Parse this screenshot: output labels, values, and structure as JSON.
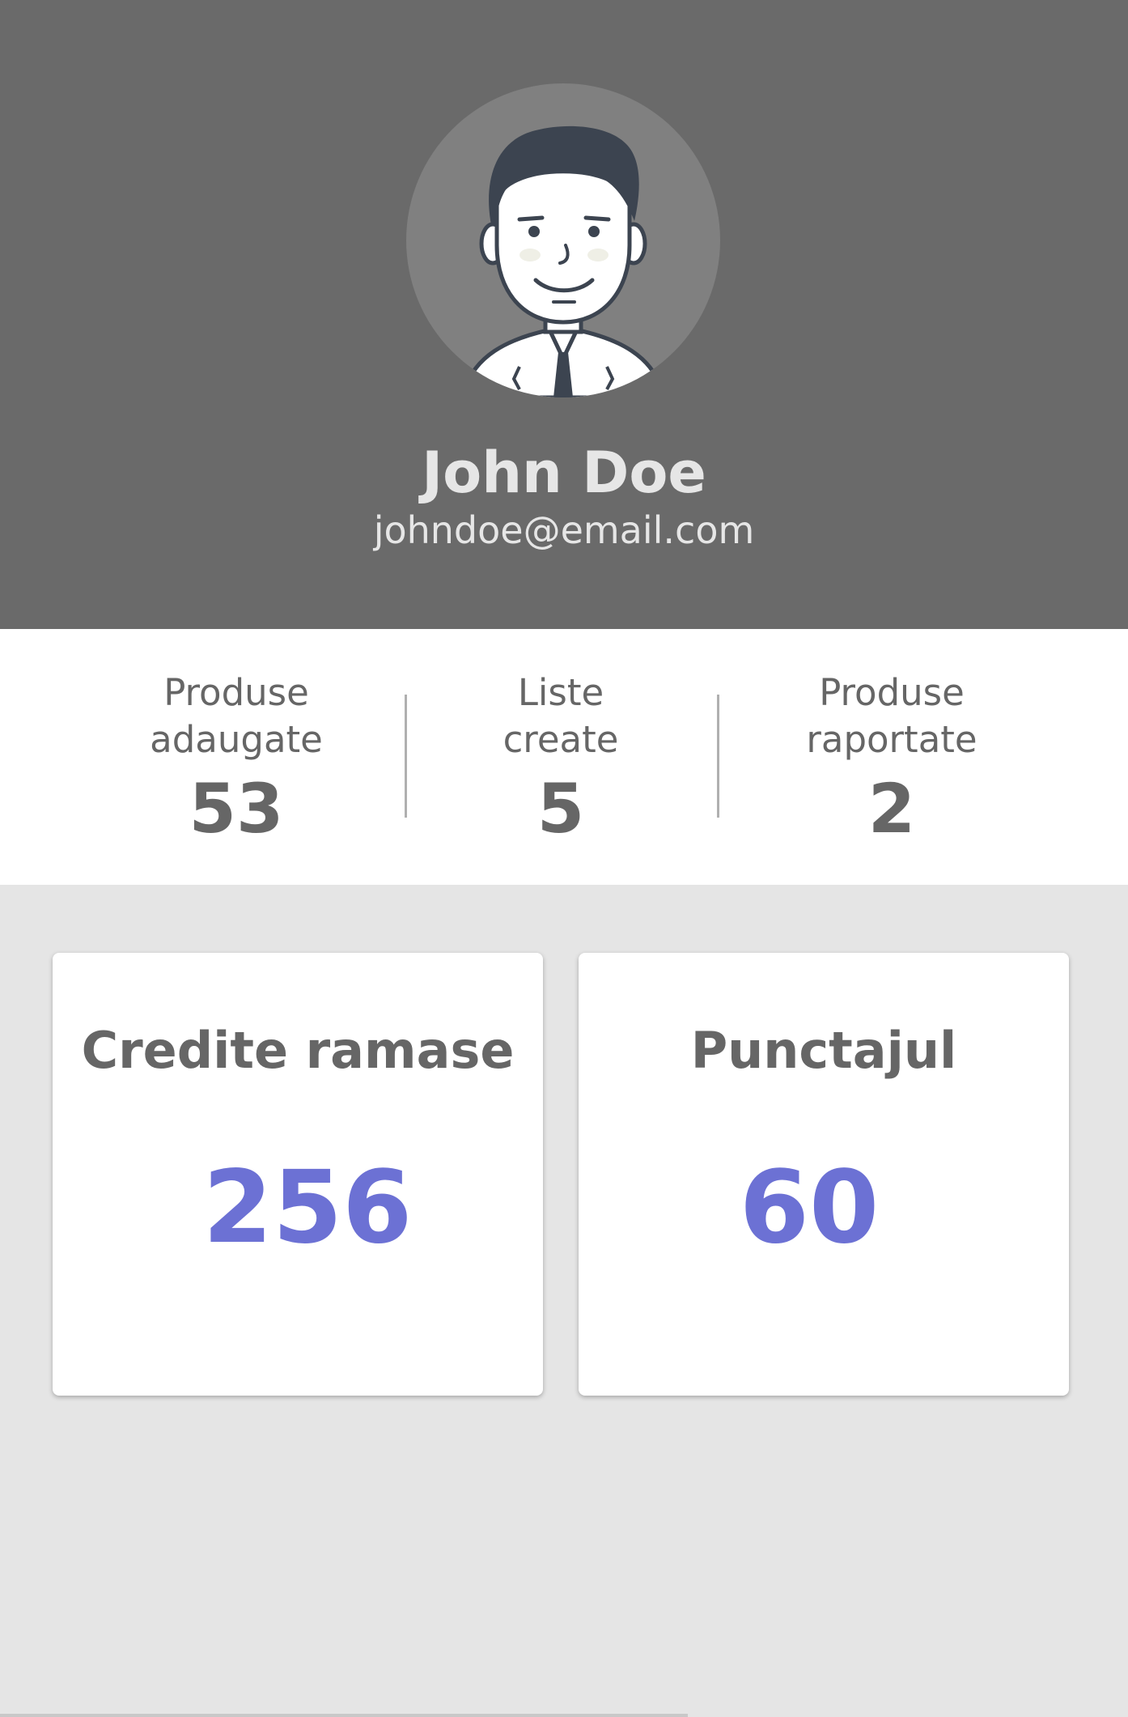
{
  "profile": {
    "name": "John Doe",
    "email": "johndoe@email.com",
    "avatar_icon": "person-avatar-icon"
  },
  "stats": [
    {
      "label": "Produse\nadaugate",
      "value": "53"
    },
    {
      "label": "Liste\ncreate",
      "value": "5"
    },
    {
      "label": "Produse\nraportate",
      "value": "2"
    }
  ],
  "cards": [
    {
      "title": "Credite ramase",
      "value": "256"
    },
    {
      "title": "Punctajul",
      "value": "60"
    }
  ],
  "colors": {
    "header_bg": "#6a6a6a",
    "accent": "#6c71d4",
    "text_gray": "#666666",
    "page_bg": "#e5e5e5"
  }
}
